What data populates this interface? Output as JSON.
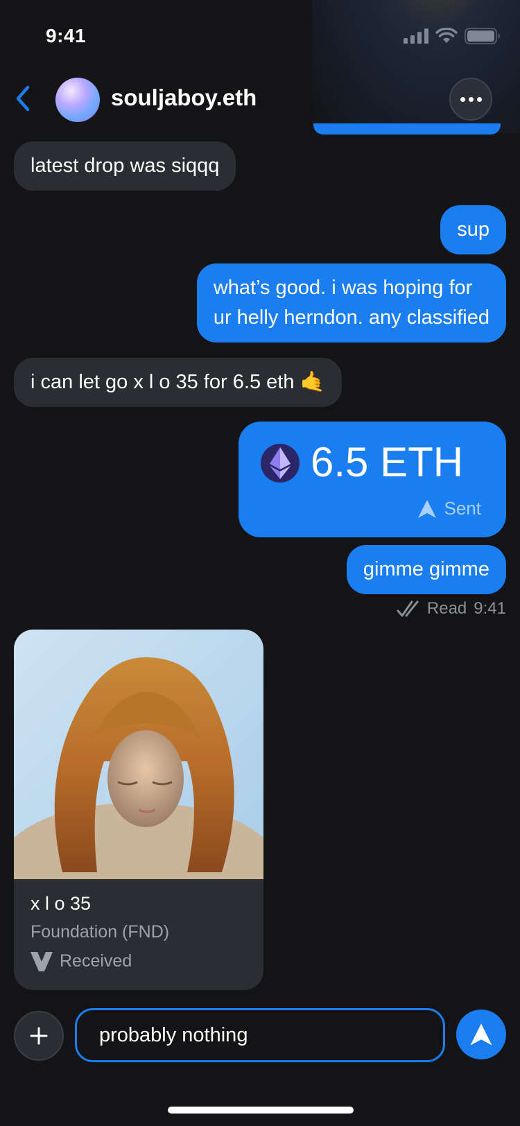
{
  "status_bar": {
    "time": "9:41"
  },
  "header": {
    "contact_name": "souljaboy.eth"
  },
  "messages": [
    {
      "direction": "in",
      "text": "latest drop was siqqq"
    },
    {
      "direction": "out",
      "text": "sup"
    },
    {
      "direction": "out",
      "line1": "what’s good. i was hoping for",
      "line2": "ur helly herndon. any classified"
    },
    {
      "direction": "in",
      "text": "i can let go x l o 35 for 6.5 eth 🤙"
    },
    {
      "direction": "out",
      "type": "payment",
      "amount": "6.5 ETH",
      "status": "Sent"
    },
    {
      "direction": "out",
      "text": "gimme gimme"
    }
  ],
  "read_receipt": {
    "label": "Read",
    "time": "9:41"
  },
  "nft": {
    "title": "x l o 35",
    "collection": "Foundation (FND)",
    "status": "Received"
  },
  "composer": {
    "value": "probably nothing"
  },
  "colors": {
    "accent": "#1a7ef0",
    "incoming_bubble": "#2a2d31",
    "background": "#141416"
  },
  "icons": [
    "back-chevron-icon",
    "more-icon",
    "ethereum-icon",
    "send-icon",
    "double-check-icon",
    "foundation-icon",
    "plus-icon"
  ]
}
